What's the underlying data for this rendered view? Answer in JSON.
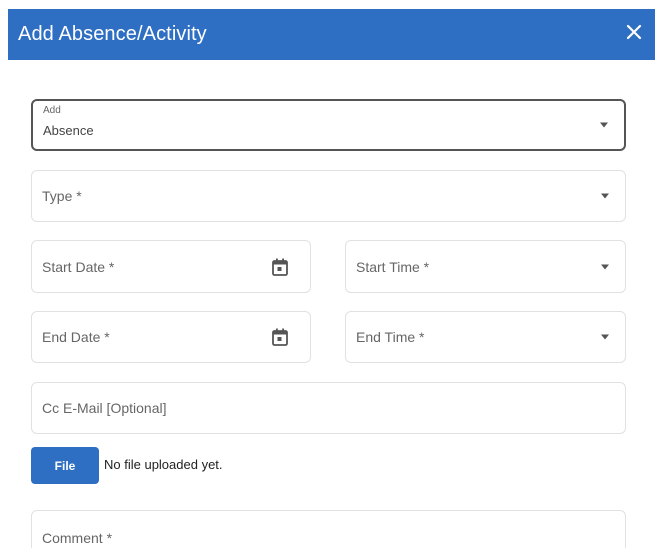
{
  "dialog": {
    "title": "Add Absence/Activity",
    "close_icon": "close-icon"
  },
  "form": {
    "add": {
      "label": "Add",
      "value": "Absence"
    },
    "type": {
      "placeholder": "Type *"
    },
    "start_date": {
      "placeholder": "Start Date *",
      "icon": "calendar-icon"
    },
    "start_time": {
      "placeholder": "Start Time *"
    },
    "end_date": {
      "placeholder": "End Date *",
      "icon": "calendar-icon"
    },
    "end_time": {
      "placeholder": "End Time *"
    },
    "cc_email": {
      "placeholder": "Cc E-Mail [Optional]"
    },
    "file": {
      "button_label": "File",
      "status": "No file uploaded yet."
    },
    "comment": {
      "placeholder": "Comment *"
    }
  },
  "colors": {
    "accent": "#2f6fc3"
  }
}
